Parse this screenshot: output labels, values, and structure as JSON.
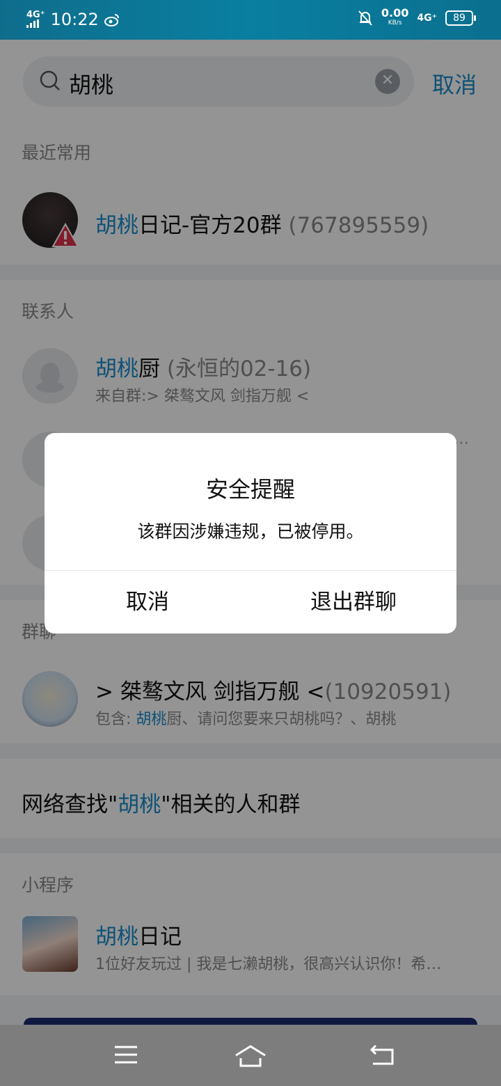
{
  "status_bar": {
    "network_left": "4G⁺",
    "time": "10:22",
    "speed_value": "0.00",
    "speed_unit": "KB/s",
    "network_right": "4G⁺",
    "battery": "89"
  },
  "search": {
    "query": "胡桃",
    "cancel_label": "取消"
  },
  "recent": {
    "title": "最近常用",
    "items": [
      {
        "name_highlight": "胡桃",
        "name_rest": "日记-官方20群",
        "id": " (767895559)"
      }
    ]
  },
  "contacts": {
    "title": "联系人",
    "items": [
      {
        "name_highlight": "胡桃",
        "name_rest": "厨",
        "note": " (永恒的02-16)",
        "sub": "来自群:> 桀骜文风 剑指万舰 <"
      }
    ]
  },
  "groups": {
    "title": "群聊",
    "items": [
      {
        "name": "> 桀骜文风 剑指万舰 <",
        "id": "(10920591)",
        "sub_prefix": "包含: ",
        "sub_highlight": "胡桃",
        "sub_rest": "厨、请问您要来只胡桃吗？、胡桃"
      }
    ]
  },
  "network_search": {
    "prefix": "网络查找\"",
    "keyword": "胡桃",
    "suffix": "\"相关的人和群"
  },
  "mini_programs": {
    "title": "小程序",
    "items": [
      {
        "name_highlight": "胡桃",
        "name_rest": "日记",
        "sub": "1位好友玩过 | 我是七濑胡桃，很高兴认识你！希…"
      }
    ]
  },
  "dialog": {
    "title": "安全提醒",
    "message": "该群因涉嫌违规，已被停用。",
    "cancel_label": "取消",
    "exit_label": "退出群聊"
  },
  "colors": {
    "accent": "#1a8ccc",
    "status_bar": "#0a7fa0",
    "nav_bar": "#7d7d7d"
  }
}
